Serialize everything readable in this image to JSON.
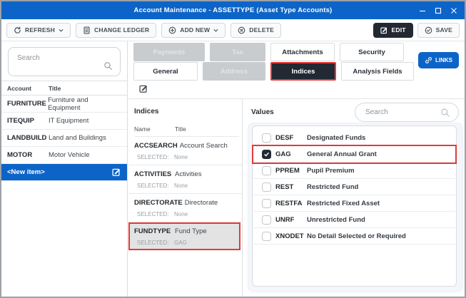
{
  "window": {
    "title": "Account Maintenance - ASSETTYPE (Asset Type Accounts)"
  },
  "toolbar": {
    "refresh_label": "REFRESH",
    "change_ledger_label": "CHANGE LEDGER",
    "add_new_label": "ADD NEW",
    "delete_label": "DELETE",
    "edit_label": "EDIT",
    "save_label": "SAVE"
  },
  "accounts_panel": {
    "search_placeholder": "Search",
    "columns": [
      "Account",
      "Title"
    ],
    "rows": [
      {
        "account": "FURNITURE",
        "title": "Furniture and Equipment",
        "selected": false
      },
      {
        "account": "ITEQUIP",
        "title": "IT Equipment",
        "selected": false
      },
      {
        "account": "LANDBUILD",
        "title": "Land and Buildings",
        "selected": false
      },
      {
        "account": "MOTOR",
        "title": "Motor Vehicle",
        "selected": false
      },
      {
        "account": "<New item>",
        "title": "",
        "selected": true
      }
    ]
  },
  "tabs": {
    "row1": [
      {
        "label": "Payments",
        "state": "disabled"
      },
      {
        "label": "Tax",
        "state": "disabled"
      },
      {
        "label": "Attachments",
        "state": "normal"
      },
      {
        "label": "Security",
        "state": "normal"
      }
    ],
    "row2": [
      {
        "label": "General",
        "state": "normal"
      },
      {
        "label": "Address",
        "state": "disabled"
      },
      {
        "label": "Indices",
        "state": "active"
      },
      {
        "label": "Analysis Fields",
        "state": "normal"
      }
    ],
    "links_label": "LINKS"
  },
  "indices_panel": {
    "heading": "Indices",
    "columns": [
      "Name",
      "Title"
    ],
    "selected_label": "SELECTED:",
    "rows": [
      {
        "name": "ACCSEARCH",
        "title": "Account Search",
        "selected_value": "None",
        "highlighted": false
      },
      {
        "name": "ACTIVITIES",
        "title": "Activities",
        "selected_value": "None",
        "highlighted": false
      },
      {
        "name": "DIRECTORATE",
        "title": "Directorate",
        "selected_value": "None",
        "highlighted": false
      },
      {
        "name": "FUNDTYPE",
        "title": "Fund Type",
        "selected_value": "GAG",
        "highlighted": true
      }
    ]
  },
  "values_panel": {
    "heading": "Values",
    "search_placeholder": "Search",
    "rows": [
      {
        "code": "DESF",
        "title": "Designated Funds",
        "checked": false,
        "highlighted": false
      },
      {
        "code": "GAG",
        "title": "General Annual Grant",
        "checked": true,
        "highlighted": true
      },
      {
        "code": "PPREM",
        "title": "Pupil Premium",
        "checked": false,
        "highlighted": false
      },
      {
        "code": "REST",
        "title": "Restricted Fund",
        "checked": false,
        "highlighted": false
      },
      {
        "code": "RESTFA",
        "title": "Restricted Fixed Asset",
        "checked": false,
        "highlighted": false
      },
      {
        "code": "UNRF",
        "title": "Unrestricted Fund",
        "checked": false,
        "highlighted": false
      },
      {
        "code": "XNODET",
        "title": "No Detail Selected or Required",
        "checked": false,
        "highlighted": false
      }
    ]
  },
  "colors": {
    "titlebar_blue": "#0d64c8",
    "selection_blue": "#0d64c8",
    "dark_button": "#232933",
    "highlight_red": "#e23b3b",
    "disabled_tab_gray": "#c9ccce",
    "highlighted_row_gray": "#e3e3e3"
  }
}
